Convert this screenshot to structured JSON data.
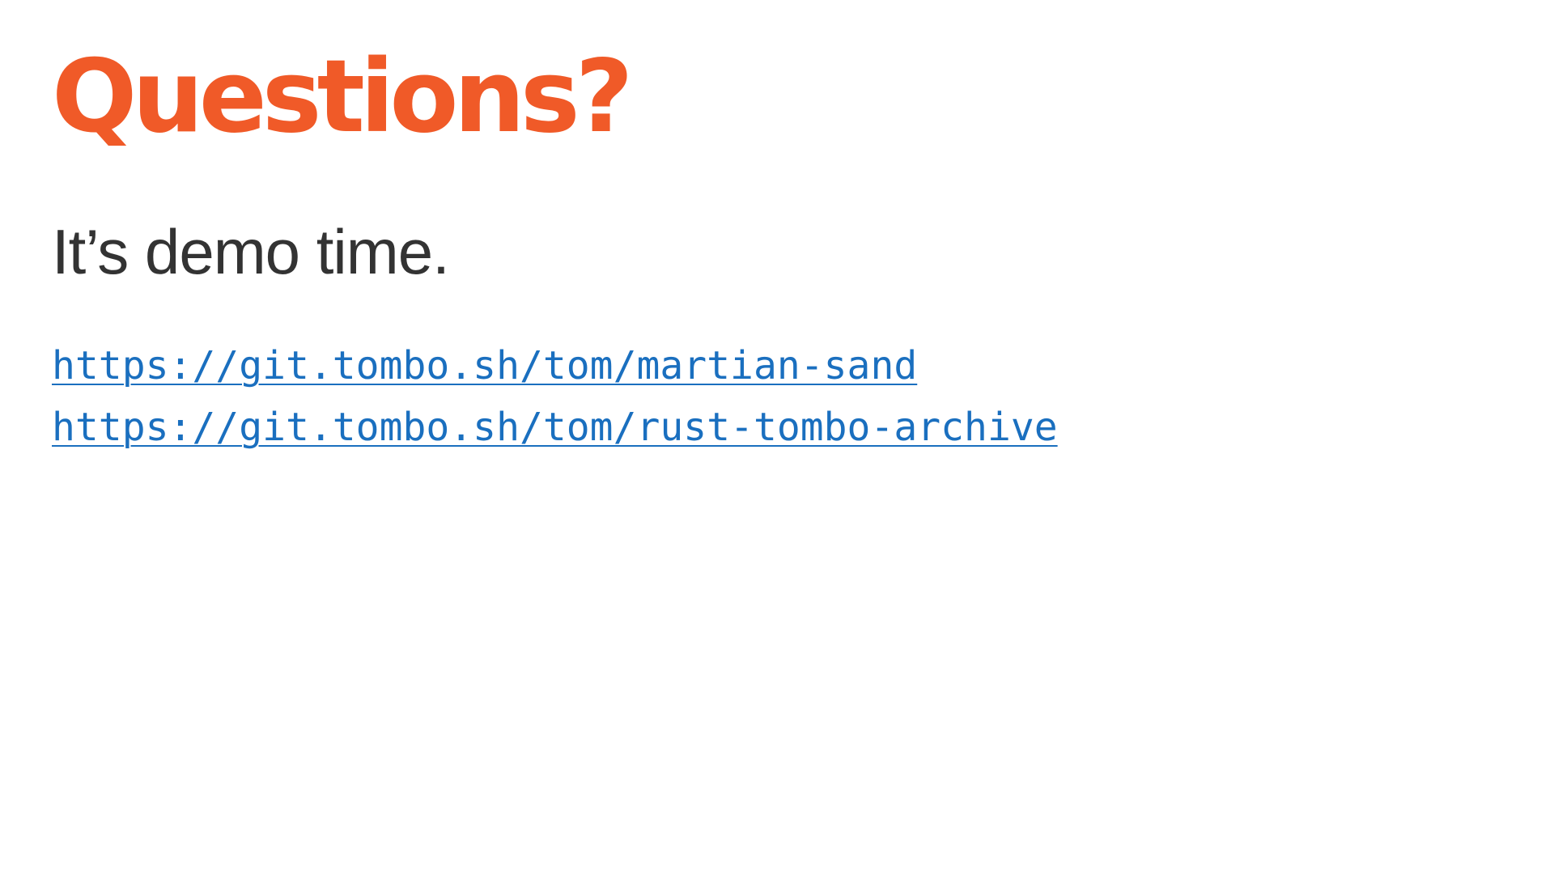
{
  "slide": {
    "title": "Questions?",
    "subtitle": "It’s demo time.",
    "links": [
      {
        "text": "https://git.tombo.sh/tom/martian-sand"
      },
      {
        "text": "https://git.tombo.sh/tom/rust-tombo-archive"
      }
    ]
  },
  "colors": {
    "title": "#f05a28",
    "body_text": "#333333",
    "link": "#1a6fbf",
    "background": "#ffffff"
  }
}
